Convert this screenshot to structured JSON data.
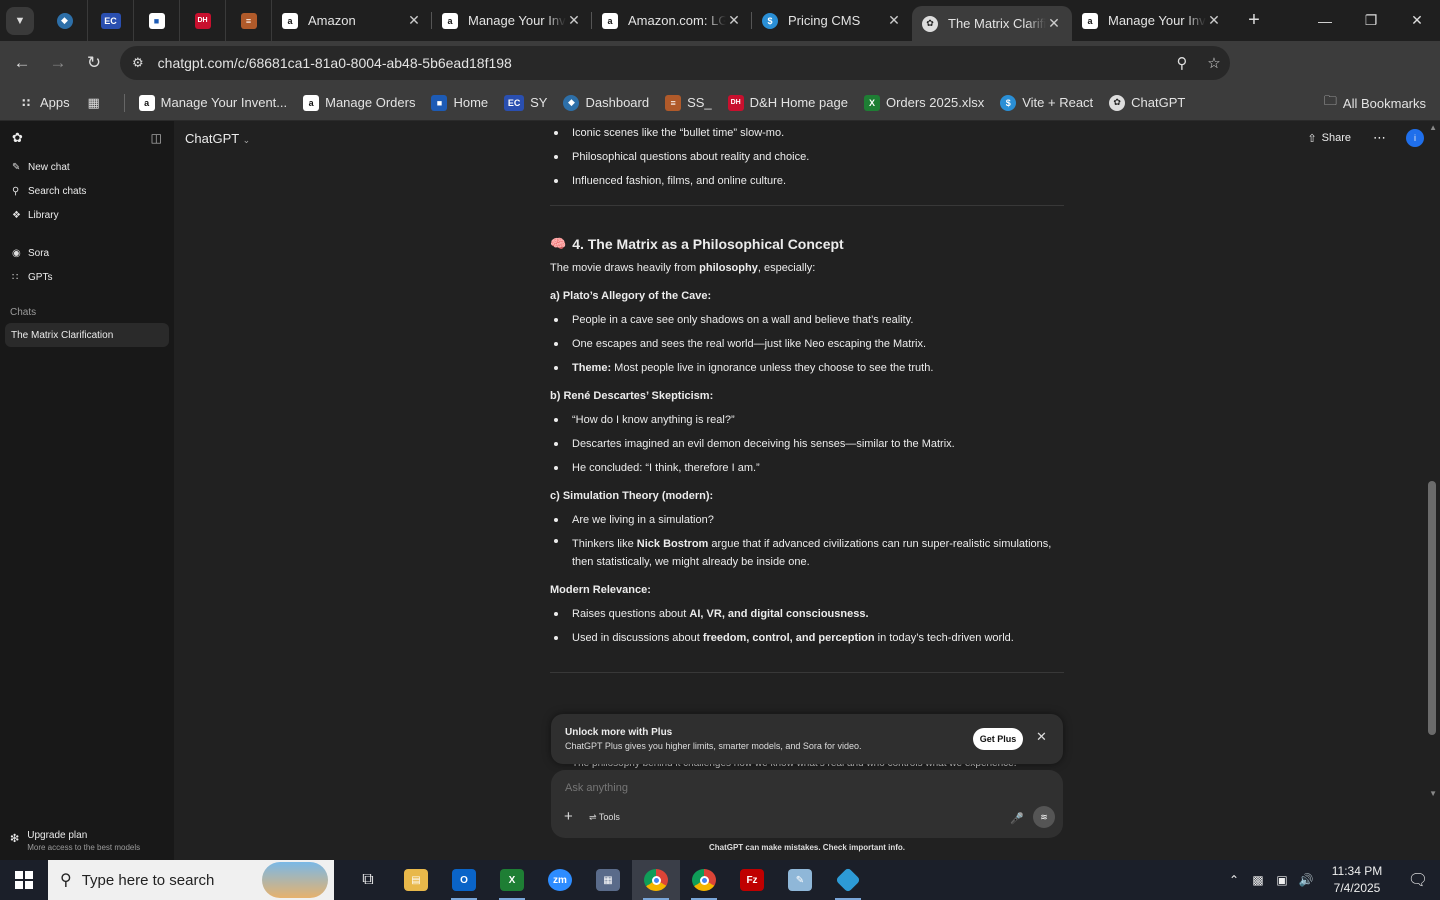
{
  "browser": {
    "tabs": [
      {
        "title": "Amazon",
        "icon": "amazon-icon"
      },
      {
        "title": "Manage Your Inventory",
        "icon": "amazon-icon"
      },
      {
        "title": "Amazon.com: LG",
        "icon": "amazon-icon"
      },
      {
        "title": "Pricing CMS",
        "icon": "dollar-icon"
      },
      {
        "title": "The Matrix Clarification",
        "icon": "chatgpt-icon",
        "active": true
      },
      {
        "title": "Manage Your Inventory",
        "icon": "amazon-icon"
      }
    ],
    "url": "chatgpt.com/c/68681ca1-81a0-8004-ab48-5b6ead18f198",
    "profile_initial": "i",
    "bookmarks": [
      "Apps",
      "Manage Your Invent...",
      "Manage Orders",
      "Home",
      "SY",
      "Dashboard",
      "SS_",
      "D&H Home page",
      "Orders 2025.xlsx",
      "Vite + React",
      "ChatGPT"
    ],
    "all_bookmarks": "All Bookmarks",
    "pinned_labels": [
      "EC",
      "DH"
    ]
  },
  "sidebar": {
    "items": [
      "New chat",
      "Search chats",
      "Library"
    ],
    "items2": [
      "Sora",
      "GPTs"
    ],
    "section": "Chats",
    "active_chat": "The Matrix Clarification",
    "upgrade_title": "Upgrade plan",
    "upgrade_sub": "More access to the best models"
  },
  "header": {
    "model": "ChatGPT",
    "share": "Share",
    "account_initial": "i"
  },
  "content": {
    "top_bullets": [
      "Iconic scenes like the “bullet time” slow-mo.",
      "Philosophical questions about reality and choice.",
      "Influenced fashion, films, and online culture."
    ],
    "heading_emoji": "🧠",
    "heading": "4. The Matrix as a Philosophical Concept",
    "intro_pre": "The movie draws heavily from ",
    "intro_bold": "philosophy",
    "intro_post": ", especially:",
    "plato_title": "a) Plato’s Allegory of the Cave:",
    "plato": [
      "People in a cave see only shadows on a wall and believe that’s reality.",
      "One escapes and sees the real world—just like Neo escaping the Matrix."
    ],
    "plato_theme_label": "Theme:",
    "plato_theme": " Most people live in ignorance unless they choose to see the truth.",
    "descartes_title": "b) René Descartes’ Skepticism:",
    "descartes": [
      "“How do I know anything is real?”",
      "Descartes imagined an evil demon deceiving his senses—similar to the Matrix.",
      "He concluded: “I think, therefore I am.”"
    ],
    "sim_title": "c) Simulation Theory (modern):",
    "sim1": "Are we living in a simulation?",
    "sim2_pre": "Thinkers like ",
    "sim2_bold": "Nick Bostrom",
    "sim2_post": " argue that if advanced civilizations can run super-realistic simulations, then statistically, we might already be inside one.",
    "modern_title": "Modern Relevance:",
    "modern1_pre": "Raises questions about ",
    "modern1_bold": "AI, VR, and digital consciousness.",
    "modern2_pre": "Used in discussions about ",
    "modern2_bold": "freedom, control, and perception",
    "modern2_post": " in today’s tech-driven world.",
    "peek_text": "The philosophy behind it challenges how we know what’s real and who controls what we experience."
  },
  "promo": {
    "title": "Unlock more with Plus",
    "subtitle": "ChatGPT Plus gives you higher limits, smarter models, and Sora for video.",
    "button": "Get Plus"
  },
  "composer": {
    "placeholder": "Ask anything",
    "tools": "Tools",
    "disclaimer": "ChatGPT can make mistakes. Check important info."
  },
  "taskbar": {
    "search_placeholder": "Type here to search",
    "time": "11:34 PM",
    "date": "7/4/2025",
    "app_labels": [
      "zm",
      "Fz"
    ]
  },
  "colors": {
    "accent_blue": "#1f6feb",
    "promo_bg": "#2f2f2f",
    "page_bg": "#212121",
    "sidebar_bg": "#181818"
  }
}
